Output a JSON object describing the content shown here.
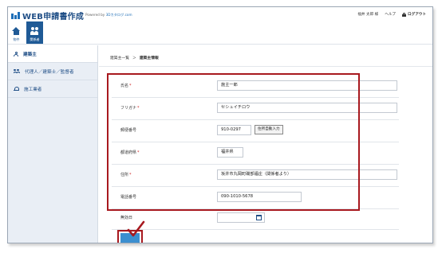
{
  "header": {
    "app_title": "WEB申請書作成",
    "powered_prefix": "Powered by",
    "powered_brand": "3Dカタログ.com",
    "user_name": "福井 太郎 様",
    "help": "ヘルプ",
    "logout": "ログアウト"
  },
  "nav": {
    "tabs": [
      {
        "label": "物件",
        "icon": "home-icon",
        "active": false
      },
      {
        "label": "関係者",
        "icon": "people-icon",
        "active": true
      }
    ]
  },
  "sidebar": {
    "items": [
      {
        "label": "建築主",
        "icon": "person-icon",
        "active": true
      },
      {
        "label": "代理人／建築士／監督者",
        "icon": "people-icon",
        "active": false
      },
      {
        "label": "施工業者",
        "icon": "helmet-icon",
        "active": false
      }
    ]
  },
  "breadcrumb": {
    "parent": "建築主一覧",
    "separator": "＞",
    "current": "建築主情報"
  },
  "form": {
    "name": {
      "label": "氏名",
      "required": "*",
      "value": "施主一郎"
    },
    "kana": {
      "label": "フリガナ",
      "required": "*",
      "value": "セシュイチロウ"
    },
    "postal": {
      "label": "郵便番号",
      "value": "910-0297",
      "button": "住所自動入力"
    },
    "prefecture": {
      "label": "都道府県",
      "required": "*",
      "value": "福井県"
    },
    "address": {
      "label": "住所",
      "required": "*",
      "value": "坂井市丸岡町磯部福庄（関係者より）"
    },
    "phone": {
      "label": "電話番号",
      "value": "090-1010-5678"
    },
    "invalid_date": {
      "label": "無効日",
      "value": ""
    }
  },
  "colors": {
    "brand_blue": "#1f5a96",
    "highlight_red": "#a8191f",
    "save_blue": "#3c8fd0",
    "sidebar_bg": "#e9eef5"
  }
}
